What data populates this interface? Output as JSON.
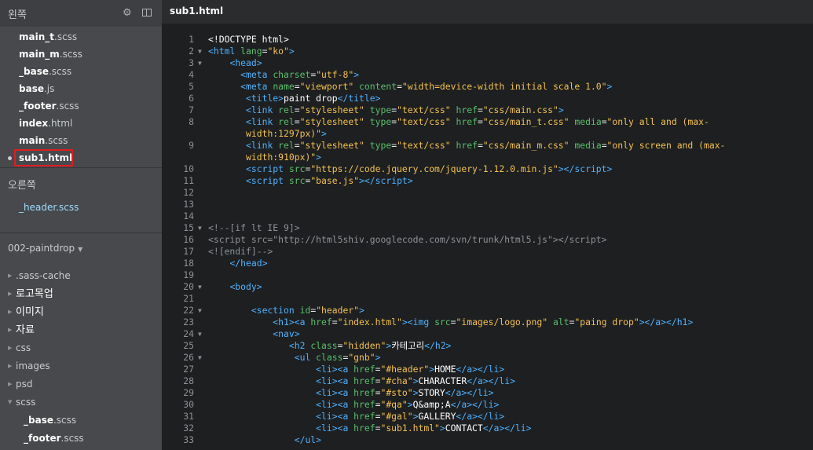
{
  "sidebar": {
    "left_title": "왼쪽",
    "right_title": "오른쪽",
    "open_files": [
      {
        "name": "main_t",
        "ext": ".scss"
      },
      {
        "name": "main_m",
        "ext": ".scss"
      },
      {
        "name": "_base",
        "ext": ".scss"
      },
      {
        "name": "base",
        "ext": ".js"
      },
      {
        "name": "_footer",
        "ext": ".scss"
      },
      {
        "name": "index",
        "ext": ".html"
      },
      {
        "name": "main",
        "ext": ".scss"
      },
      {
        "name": "sub1.html",
        "ext": ""
      }
    ],
    "right_files": [
      "_header.scss"
    ],
    "project": "002-paintdrop",
    "tree": [
      {
        "label": ".sass-cache"
      },
      {
        "label": "로고목업"
      },
      {
        "label": "이미지"
      },
      {
        "label": "자료"
      },
      {
        "label": "css"
      },
      {
        "label": "images"
      },
      {
        "label": "psd"
      },
      {
        "label": "scss"
      }
    ],
    "tree_children": [
      {
        "name": "_base",
        "ext": ".scss"
      },
      {
        "name": "_footer",
        "ext": ".scss"
      }
    ]
  },
  "editor": {
    "title": "sub1.html"
  }
}
